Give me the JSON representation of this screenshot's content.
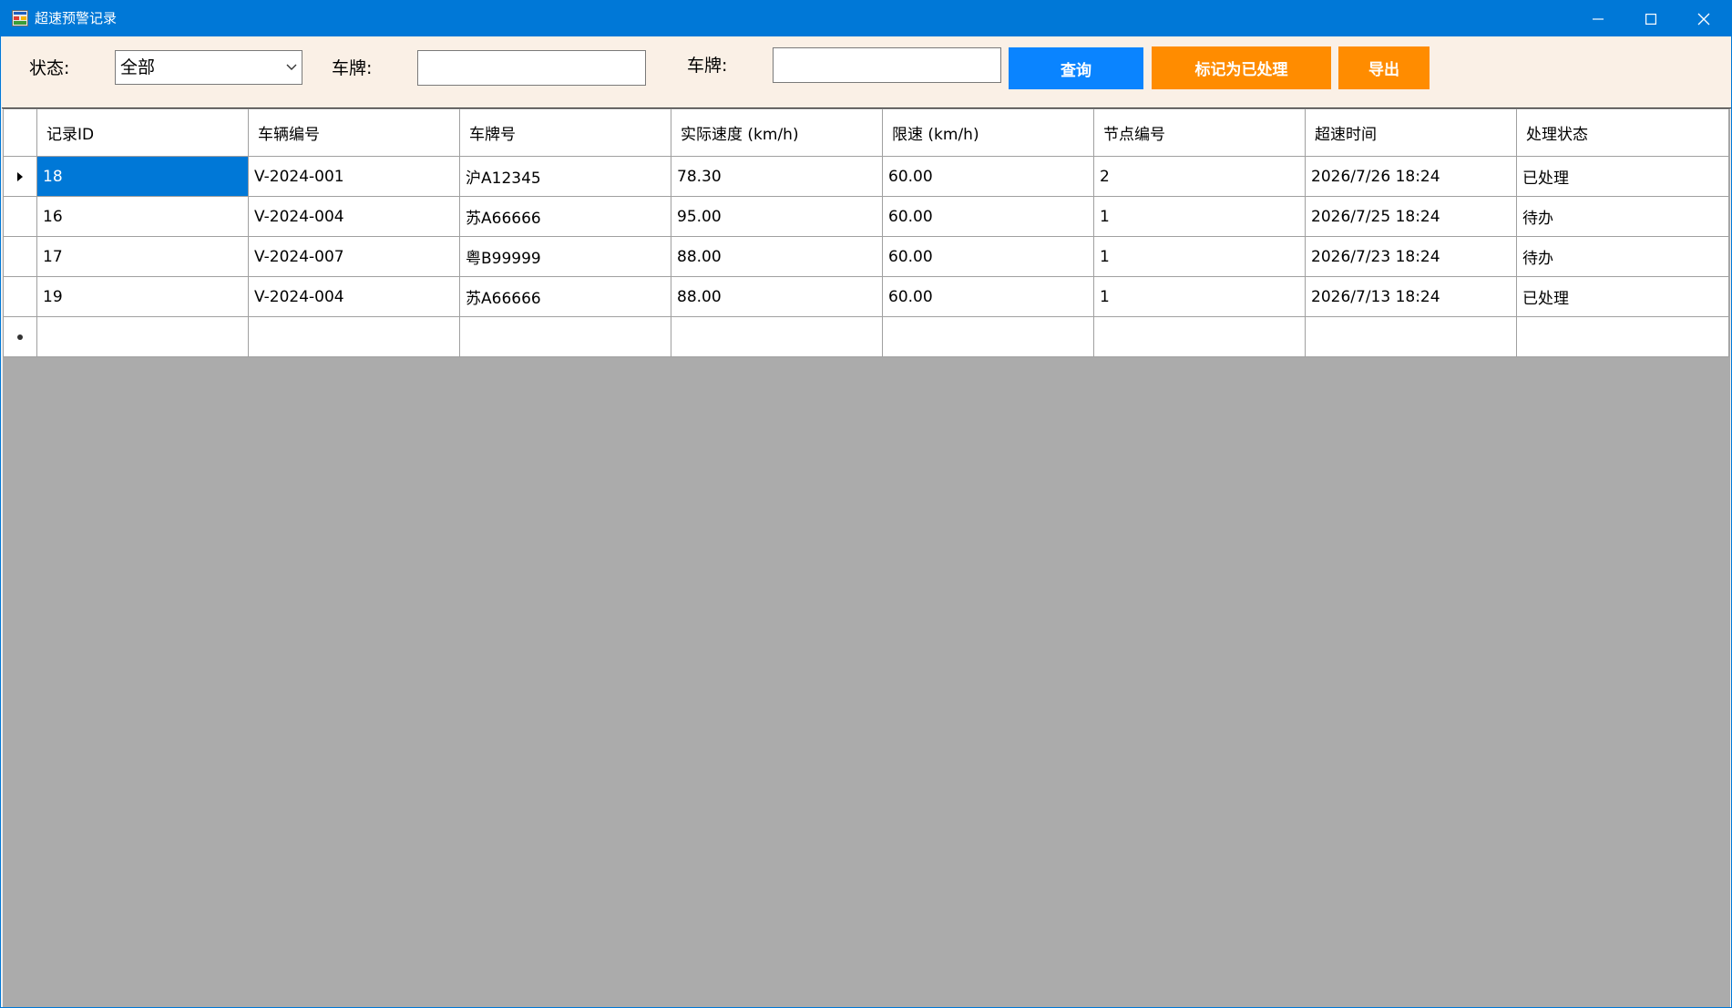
{
  "window": {
    "title": "超速预警记录",
    "accent_color": "#0078d7",
    "icon": "app-form-icon"
  },
  "toolbar": {
    "status_label": "状态:",
    "status_selected": "全部",
    "plate_label_1": "车牌:",
    "plate_value_1": "",
    "plate_label_2": "车牌:",
    "plate_value_2": "",
    "query_label": "查询",
    "mark_label": "标记为已处理",
    "export_label": "导出",
    "query_color": "#0a84ff",
    "action_color": "#ff8c00"
  },
  "grid": {
    "columns": [
      "记录ID",
      "车辆编号",
      "车牌号",
      "实际速度 (km/h)",
      "限速 (km/h)",
      "节点编号",
      "超速时间",
      "处理状态"
    ],
    "rows": [
      [
        "18",
        "V-2024-001",
        "沪A12345",
        "78.30",
        "60.00",
        "2",
        "2026/7/26 18:24",
        "已处理"
      ],
      [
        "16",
        "V-2024-004",
        "苏A66666",
        "95.00",
        "60.00",
        "1",
        "2026/7/25 18:24",
        "待办"
      ],
      [
        "17",
        "V-2024-007",
        "粤B99999",
        "88.00",
        "60.00",
        "1",
        "2026/7/23 18:24",
        "待办"
      ],
      [
        "19",
        "V-2024-004",
        "苏A66666",
        "88.00",
        "60.00",
        "1",
        "2026/7/13 18:24",
        "已处理"
      ]
    ],
    "selected_row": 0,
    "selected_color": "#0078d7",
    "empty_area_color": "#ababab"
  }
}
